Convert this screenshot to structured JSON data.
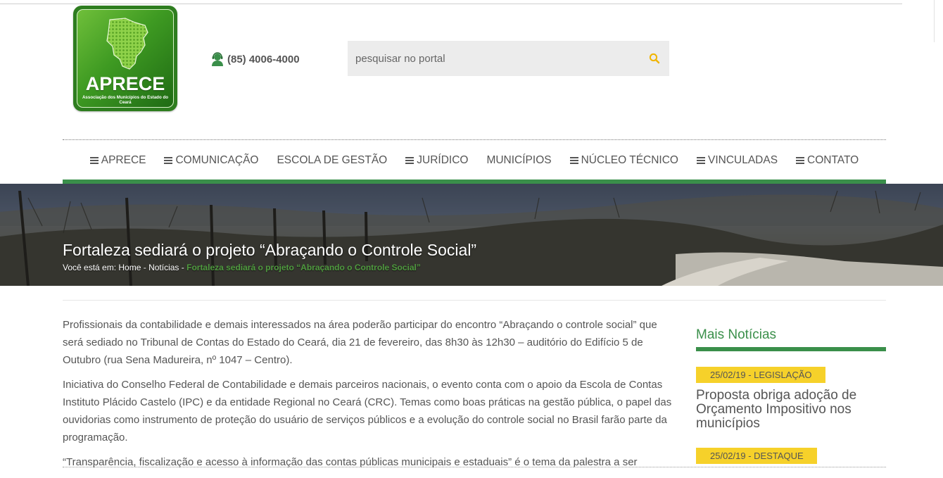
{
  "header": {
    "logo": {
      "name": "APRECE",
      "subtitle": "Associação dos Municípios do Estado do Ceará"
    },
    "phone": "(85) 4006-4000",
    "search": {
      "placeholder": "pesquisar no portal"
    }
  },
  "nav": {
    "items": [
      {
        "label": "APRECE",
        "menu": true
      },
      {
        "label": "COMUNICAÇÃO",
        "menu": true
      },
      {
        "label": "ESCOLA DE GESTÃO",
        "menu": false
      },
      {
        "label": "JURÍDICO",
        "menu": true
      },
      {
        "label": "MUNICÍPIOS",
        "menu": false
      },
      {
        "label": "NÚCLEO TÉCNICO",
        "menu": true
      },
      {
        "label": "VINCULADAS",
        "menu": true
      },
      {
        "label": "CONTATO",
        "menu": true
      }
    ]
  },
  "banner": {
    "title": "Fortaleza sediará o projeto “Abraçando o Controle Social”",
    "breadcrumb": {
      "prefix": "Você está em:",
      "home": "Home",
      "sep": " - ",
      "section": "Notícias",
      "current": "Fortaleza sediará o projeto “Abraçando o Controle Social”"
    }
  },
  "article": {
    "paragraphs": [
      "Profissionais da contabilidade e demais interessados na área poderão participar do encontro “Abraçando o controle social” que será sediado no Tribunal de Contas do Estado do Ceará, dia 21 de fevereiro, das 8h30 às 12h30 – auditório do Edifício 5 de Outubro (rua Sena Madureira, nº 1047 – Centro).",
      "Iniciativa do Conselho Federal de Contabilidade e demais parceiros nacionais, o evento conta com o apoio da Escola de Contas Instituto Plácido Castelo (IPC) e da entidade Regional no Ceará (CRC). Temas como boas práticas na gestão pública, o papel das ouvidorias como instrumento de proteção do usuário de serviços públicos e a evolução do controle social no Brasil farão parte da programação.",
      "“Transparência, fiscalização e acesso à informação das contas públicas municipais e estaduais” é o tema da palestra a ser"
    ]
  },
  "sidebar": {
    "title": "Mais Notícias",
    "news": [
      {
        "tag": "25/02/19 - LEGISLAÇÃO",
        "title": "Proposta obriga adoção de Orçamento Impositivo nos municípios"
      },
      {
        "tag": "25/02/19 - DESTAQUE",
        "title": ""
      }
    ]
  },
  "colors": {
    "green": "#3a8f4a",
    "tag_yellow": "#f6d12a",
    "text": "#555555"
  }
}
